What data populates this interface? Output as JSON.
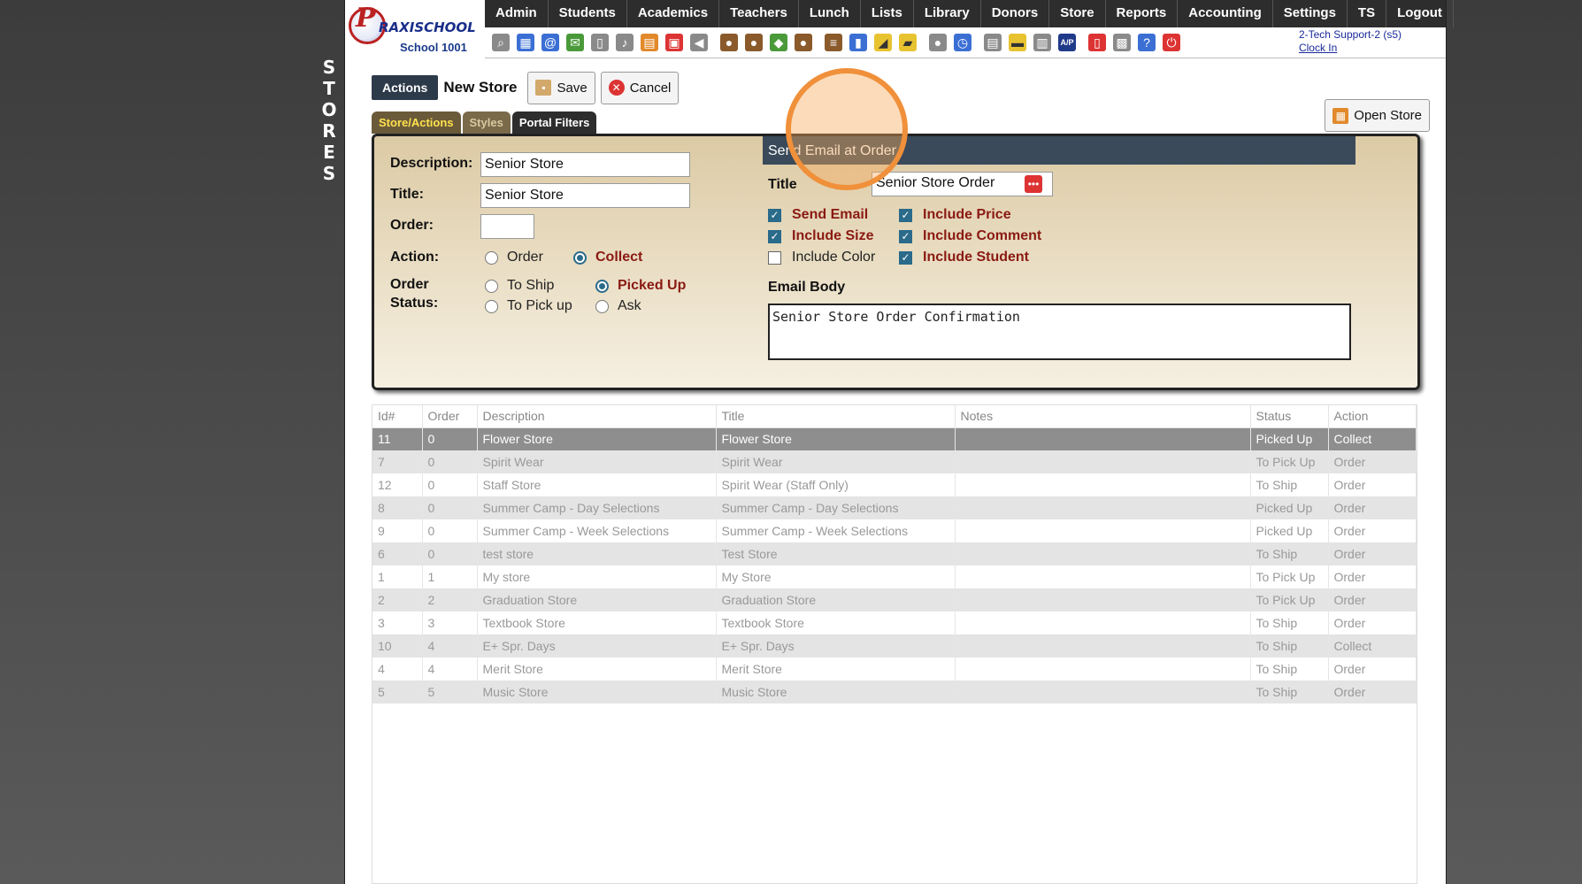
{
  "side_title": "S\nT\nO\nR\nE\nS",
  "brand": {
    "logo_letter": "P",
    "name_part1": "RAXI",
    "name_part2": "SCHOOL",
    "school": "School 1001"
  },
  "nav": [
    "Admin",
    "Students",
    "Academics",
    "Teachers",
    "Lunch",
    "Lists",
    "Library",
    "Donors",
    "Store",
    "Reports",
    "Accounting",
    "Settings",
    "TS",
    "Logout"
  ],
  "toolbar_icons": [
    "search-icon",
    "calendar-grid-icon",
    "at-sign-icon",
    "chat-icon",
    "mobile-icon",
    "speaker-icon",
    "table-icon",
    "calendar-icon",
    "megaphone-icon",
    "user-icon",
    "user-alt-icon",
    "tag-icon",
    "users-icon",
    "hamburger-icon",
    "book-icon",
    "bell-icon",
    "note-icon",
    "contact-icon",
    "clock-icon",
    "document-icon",
    "card-icon",
    "printer-icon",
    "ap-icon",
    "pdf-icon",
    "money-icon",
    "help-icon",
    "power-icon"
  ],
  "user": {
    "name": "2-Tech Support-2 (s5)",
    "clock_in": "Clock In"
  },
  "actions": {
    "label": "Actions",
    "form_title": "New Store",
    "save": "Save",
    "cancel": "Cancel",
    "open_store": "Open Store"
  },
  "tabs": [
    "Store/Actions",
    "Styles",
    "Portal Filters"
  ],
  "form": {
    "description_label": "Description:",
    "description_value": "Senior Store",
    "title_label": "Title:",
    "title_value": "Senior Store",
    "order_label": "Order:",
    "order_value": "",
    "action_label": "Action:",
    "action_options": [
      "Order",
      "Collect"
    ],
    "action_selected": "Collect",
    "status_label_1": "Order",
    "status_label_2": "Status:",
    "status_options": [
      "To Ship",
      "Picked Up",
      "To Pick up",
      "Ask"
    ],
    "status_selected": "Picked Up"
  },
  "email": {
    "header": "Send Email at Order",
    "title_label": "Title",
    "title_value": "Senior Store Order",
    "checks": [
      {
        "label": "Send Email",
        "checked": true
      },
      {
        "label": "Include Price",
        "checked": true
      },
      {
        "label": "Include Size",
        "checked": true
      },
      {
        "label": "Include Comment",
        "checked": true
      },
      {
        "label": "Include Color",
        "checked": false
      },
      {
        "label": "Include Student",
        "checked": true
      }
    ],
    "body_label": "Email Body",
    "body_value": "Senior Store Order Confirmation"
  },
  "table": {
    "columns": [
      "Id#",
      "Order",
      "Description",
      "Title",
      "Notes",
      "Status",
      "Action"
    ],
    "rows": [
      [
        "11",
        "0",
        "Flower Store",
        "Flower Store",
        "",
        "Picked Up",
        "Collect"
      ],
      [
        "7",
        "0",
        "Spirit Wear",
        "Spirit Wear",
        "",
        "To Pick Up",
        "Order"
      ],
      [
        "12",
        "0",
        "Staff Store",
        "Spirit Wear (Staff Only)",
        "",
        "To Ship",
        "Order"
      ],
      [
        "8",
        "0",
        "Summer Camp - Day Selections",
        "Summer Camp - Day Selections",
        "",
        "Picked Up",
        "Order"
      ],
      [
        "9",
        "0",
        "Summer Camp - Week Selections",
        "Summer Camp - Week Selections",
        "",
        "Picked Up",
        "Order"
      ],
      [
        "6",
        "0",
        "test store",
        "Test Store",
        "",
        "To Ship",
        "Order"
      ],
      [
        "1",
        "1",
        "My store",
        "My Store",
        "",
        "To Pick Up",
        "Order"
      ],
      [
        "2",
        "2",
        "Graduation Store",
        "Graduation Store",
        "",
        "To Pick Up",
        "Order"
      ],
      [
        "3",
        "3",
        "Textbook Store",
        "Textbook Store",
        "",
        "To Ship",
        "Order"
      ],
      [
        "10",
        "4",
        "E+ Spr. Days",
        "E+ Spr. Days",
        "",
        "To Ship",
        "Collect"
      ],
      [
        "4",
        "4",
        "Merit Store",
        "Merit Store",
        "",
        "To Ship",
        "Order"
      ],
      [
        "5",
        "5",
        "Music Store",
        "Music Store",
        "",
        "To Ship",
        "Order"
      ]
    ],
    "selected_row": 0
  }
}
